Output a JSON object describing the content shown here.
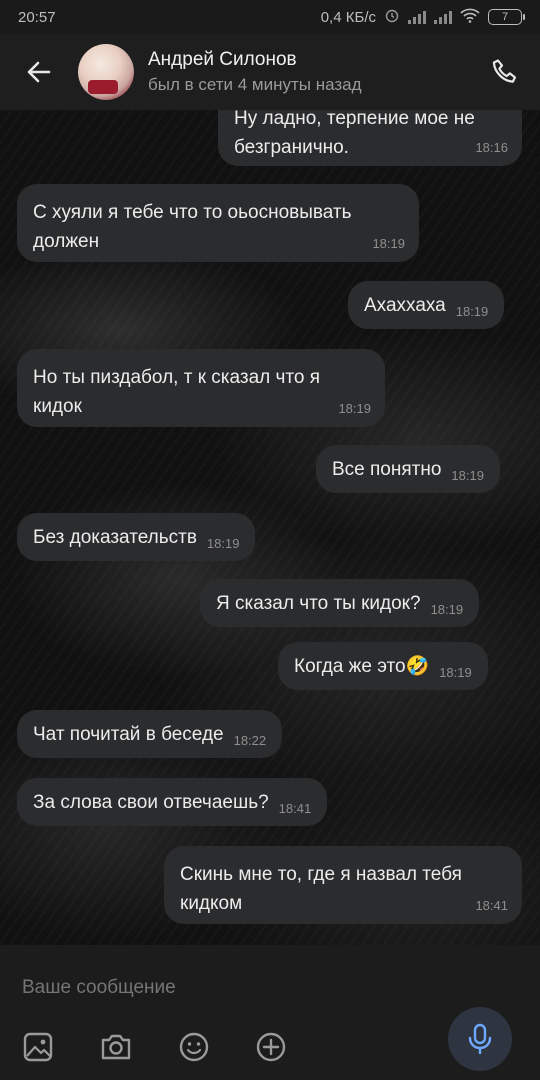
{
  "status_bar": {
    "time": "20:57",
    "network_speed": "0,4 КБ/с",
    "battery": "7"
  },
  "header": {
    "contact_name": "Андрей Силонов",
    "presence": "был в сети 4 минуты назад"
  },
  "messages": [
    {
      "side": "out",
      "text": "Ну ладно, терпение мое не безгранично.",
      "time": "18:16"
    },
    {
      "side": "in",
      "text": "С хуяли я тебе что то оьосновывать должен",
      "time": "18:19"
    },
    {
      "side": "out",
      "text": "Ахаххаха",
      "time": "18:19"
    },
    {
      "side": "in",
      "text": "Но ты пиздабол, т к сказал что я кидок",
      "time": "18:19"
    },
    {
      "side": "out",
      "text": "Все понятно",
      "time": "18:19"
    },
    {
      "side": "in",
      "text": "Без доказательств",
      "time": "18:19"
    },
    {
      "side": "out",
      "text": "Я сказал что ты кидок?",
      "time": "18:19"
    },
    {
      "side": "out",
      "text": "Когда же это🤣",
      "time": "18:19"
    },
    {
      "side": "in",
      "text": "Чат почитай в беседе",
      "time": "18:22"
    },
    {
      "side": "in",
      "text": "За слова свои отвечаешь?",
      "time": "18:41"
    },
    {
      "side": "out",
      "text": "Скинь мне то, где я назвал тебя кидком",
      "time": "18:41"
    }
  ],
  "composer": {
    "placeholder": "Ваше сообщение",
    "icons": [
      "gallery-icon",
      "camera-icon",
      "emoji-icon",
      "add-icon",
      "microphone-icon"
    ]
  },
  "colors": {
    "bubble": "#2b2c2e",
    "accent": "#6ea8ff"
  }
}
